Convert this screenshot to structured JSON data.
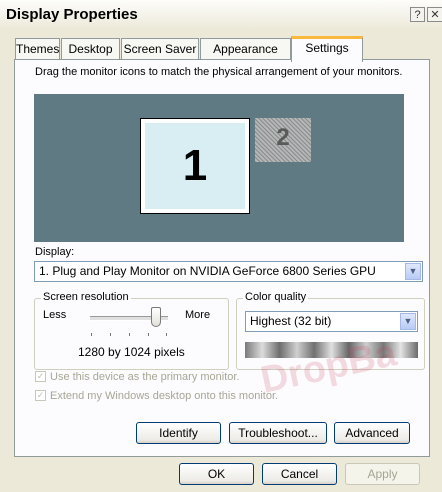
{
  "window": {
    "title": "Display Properties",
    "help_icon": "?",
    "close_icon": "✕"
  },
  "tabs": [
    {
      "label": "Themes"
    },
    {
      "label": "Desktop"
    },
    {
      "label": "Screen Saver"
    },
    {
      "label": "Appearance"
    },
    {
      "label": "Settings"
    }
  ],
  "settings": {
    "instructions": "Drag the monitor icons to match the physical arrangement of your monitors.",
    "monitors": {
      "primary": "1",
      "secondary": "2"
    },
    "display_label": "Display:",
    "display_value": "1. Plug and Play Monitor on NVIDIA GeForce 6800 Series GPU",
    "resolution": {
      "legend": "Screen resolution",
      "less": "Less",
      "more": "More",
      "value_text": "1280 by 1024 pixels"
    },
    "color_quality": {
      "legend": "Color quality",
      "value": "Highest (32 bit)"
    },
    "checkboxes": [
      {
        "label": "Use this device as the primary monitor.",
        "checked": true
      },
      {
        "label": "Extend my Windows desktop onto this monitor.",
        "checked": true
      }
    ],
    "buttons": {
      "identify": "Identify",
      "troubleshoot": "Troubleshoot...",
      "advanced": "Advanced"
    }
  },
  "footer": {
    "ok": "OK",
    "cancel": "Cancel",
    "apply": "Apply"
  },
  "watermark": "DropBa"
}
